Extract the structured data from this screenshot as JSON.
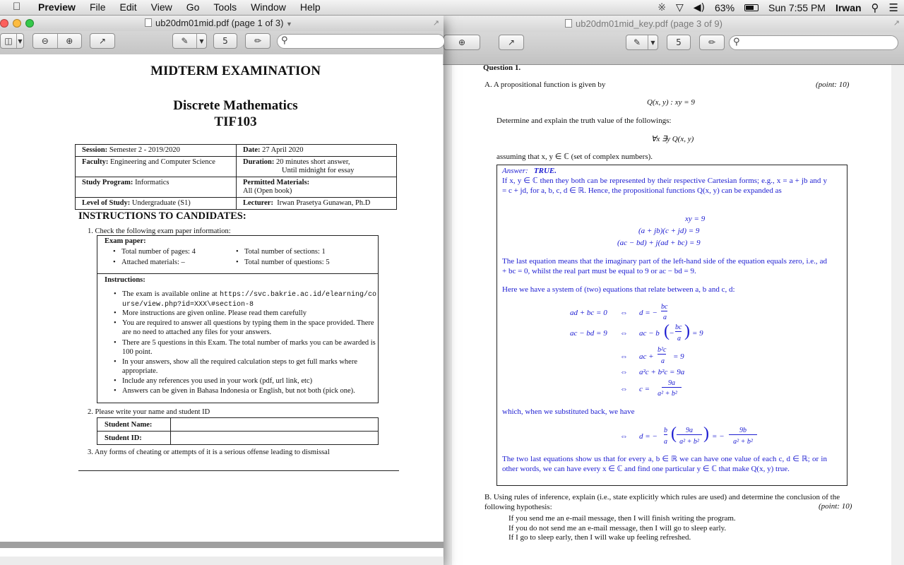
{
  "menubar": {
    "app_name": "Preview",
    "items": [
      "File",
      "Edit",
      "View",
      "Go",
      "Tools",
      "Window",
      "Help"
    ],
    "battery": "63%",
    "clock": "Sun 7:55 PM",
    "user": "Irwan"
  },
  "left_window": {
    "title": "ub20dm01mid.pdf (page 1 of 3)",
    "search_placeholder": "",
    "toolbar": {
      "rotate_label": "5"
    },
    "doc": {
      "heading": "MIDTERM EXAMINATION",
      "course": "Discrete Mathematics",
      "code": "TIF103",
      "info": {
        "session_label": "Session:",
        "session": "Semester 2 - 2019/2020",
        "date_label": "Date:",
        "date": "27 April 2020",
        "faculty_label": "Faculty:",
        "faculty": "Engineering and Computer Science",
        "duration_label": "Duration:",
        "duration_1": "20 minutes short answer,",
        "duration_2": "Until midnight for essay",
        "program_label": "Study Program:",
        "program": "Informatics",
        "materials_label": "Permitted Materials:",
        "materials": "All (Open book)",
        "level_label": "Level of Study:",
        "level": "Undergraduate (S1)",
        "lecturer_label": "Lecturer:",
        "lecturer": "Irwan Prasetya Gunawan, Ph.D"
      },
      "instructions_heading": "INSTRUCTIONS TO CANDIDATES:",
      "item1": "1.  Check the following exam paper information:",
      "exam_paper_label": "Exam paper:",
      "pages": "Total number of pages: 4",
      "sections": "Total number of sections: 1",
      "attached": "Attached materials: –",
      "questions": "Total number of questions: 5",
      "instructions_label": "Instructions:",
      "bullet1_a": "The exam is available online at",
      "bullet1_url": "https://svc.bakrie.ac.id/elearning/course/view.php?id=XXX\\#section-8",
      "bullet2": "More instructions are given online. Please read them carefully",
      "bullet3": "You are required to answer all questions by typing them in the space provided. There are no need to attached any files for your answers.",
      "bullet4": "There are 5 questions in this Exam.  The total number of marks you can be awarded is 100 point.",
      "bullet5": "In your answers, show all the required calculation steps to get full marks where appropriate.",
      "bullet6": "Include any references you used in your work (pdf, url link, etc)",
      "bullet7": "Answers can be given in Bahasa Indonesia or English, but not both (pick one).",
      "item2": "2.  Please write your name and student ID",
      "student_name_label": "Student Name:",
      "student_id_label": "Student ID:",
      "item3": "3.  Any forms of cheating or attempts of it is a serious offense leading to dismissal"
    }
  },
  "right_window": {
    "title": "ub20dm01mid_key.pdf (page 3 of 9)",
    "toolbar": {
      "rotate_label": "5"
    },
    "doc": {
      "question": "Question 1.",
      "partA": "A.  A propositional function is given by",
      "points_a": "(point: 10)",
      "eq1": "Q(x, y) : xy = 9",
      "determine": "Determine and explain the truth value of the followings:",
      "eq2": "∀x ∃y Q(x, y)",
      "assuming": "assuming that x, y ∈ ℂ (set of complex numbers).",
      "answer_label": "Answer:",
      "answer_value": "TRUE.",
      "ans_p1": "If x, y ∈ ℂ then they both can be represented by their respective Cartesian forms; e.g., x = a + jb and y = c + jd, for a, b, c, d ∈ ℝ. Hence, the propositional functions Q(x, y) can be expanded as",
      "ans_eq1": "xy = 9",
      "ans_eq2": "(a + jb)(c + jd) = 9",
      "ans_eq3": "(ac − bd) + j(ad + bc) = 9",
      "ans_p2": "The last equation means that the imaginary part of the left-hand side of the equation equals zero, i.e., ad + bc = 0, whilst the real part must be equal to 9 or ac − bd = 9.",
      "ans_p3": "Here we have a system of (two) equations that relate between a, b and c, d:",
      "sys_l1": "ad + bc = 0",
      "sys_r1": "d = −",
      "sys_r1_num": "bc",
      "sys_r1_den": "a",
      "sys_l2": "ac − bd = 9",
      "sys_r2": "ac − b",
      "sys_r2_tail": "= 9",
      "sys_r3": "ac +",
      "sys_r3_num": "b²c",
      "sys_r3_den": "a",
      "sys_r3_tail": "= 9",
      "sys_r4": "a²c + b²c = 9a",
      "sys_r5": "c =",
      "sys_r5_num": "9a",
      "sys_r5_den": "a² + b²",
      "iff": "⇔",
      "ans_p4": "which, when we substituted back, we have",
      "back_r": "d = −",
      "back_num1": "b",
      "back_den1": "a",
      "back_num2": "9a",
      "back_den2": "a² + b²",
      "back_eq": "= −",
      "back_num3": "9b",
      "back_den3": "a² + b²",
      "ans_p5": "The two last equations show us that for every a, b ∈ ℝ we can have one value of each c, d ∈ ℝ; or in other words, we can have every x ∈ ℂ and find one particular y ∈ ℂ that make Q(x, y) true.",
      "partB": "B.  Using rules of inference, explain (i.e., state explicitly which rules are used) and determine the conclusion of the following hypothesis:",
      "points_b": "(point: 10)",
      "hyp1": "If you send me an e-mail message, then I will finish writing the program.",
      "hyp2": "If you do not send me an e-mail message, then I will go to sleep early.",
      "hyp3": "If I go to sleep early, then I will wake up feeling refreshed."
    }
  }
}
